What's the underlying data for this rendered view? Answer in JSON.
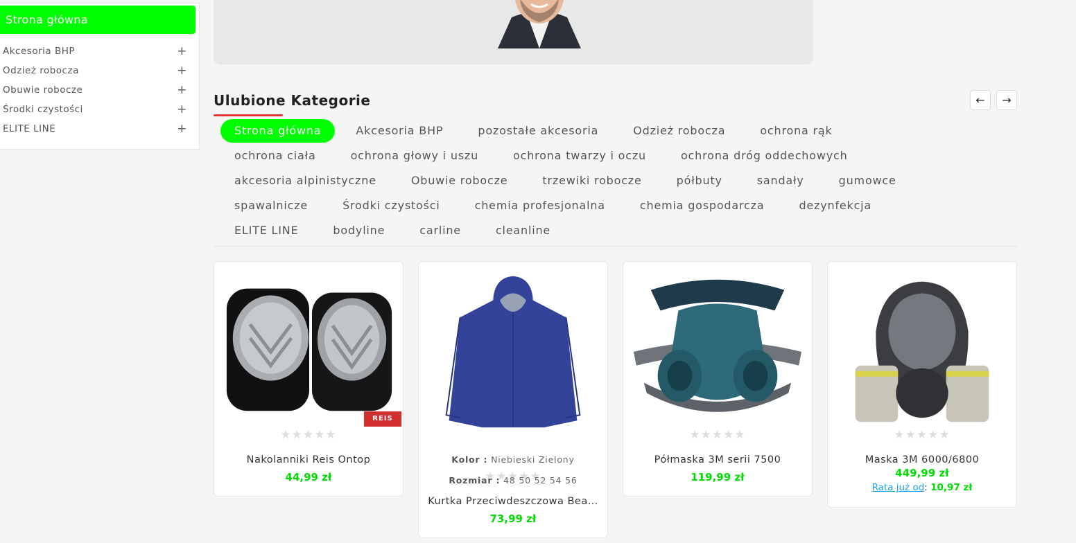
{
  "sidebar": {
    "heading": "Strona główna",
    "items": [
      {
        "label": "Akcesoria BHP",
        "expand": "+"
      },
      {
        "label": "Odzież robocza",
        "expand": "+"
      },
      {
        "label": "Obuwie robocze",
        "expand": "+"
      },
      {
        "label": "Środki czystości",
        "expand": "+"
      },
      {
        "label": "ELITE LINE",
        "expand": "+"
      }
    ]
  },
  "section": {
    "title": "Ulubione Kategorie",
    "prev": "←",
    "next": "→",
    "accent_color": "#e53935"
  },
  "categories": {
    "active_color": "#00ff00",
    "rows": [
      [
        "Strona główna",
        "Akcesoria BHP",
        "pozostałe akcesoria",
        "Odzież robocza",
        "ochrona rąk"
      ],
      [
        "ochrona ciała",
        "ochrona głowy i uszu",
        "ochrona twarzy i oczu",
        "ochrona dróg oddechowych"
      ],
      [
        "akcesoria alpinistyczne",
        "Obuwie robocze",
        "trzewiki robocze",
        "półbuty",
        "sandały",
        "gumowce"
      ],
      [
        "spawalnicze",
        "Środki czystości",
        "chemia profesjonalna",
        "chemia gospodarcza",
        "dezynfekcja"
      ],
      [
        "ELITE LINE",
        "bodyline",
        "carline",
        "cleanline"
      ]
    ]
  },
  "products": [
    {
      "name": "Nakolanniki Reis Ontop",
      "price": "44,99 zł",
      "stars": "★★★★★",
      "badge": "REIS"
    },
    {
      "name": "Kurtka Przeciwdeszczowa Bea…",
      "price": "73,99 zł",
      "stars": "★★★★★",
      "color_label": "Kolor :",
      "colors": "Niebieski  Zielony",
      "size_label": "Rozmiar :",
      "sizes": "48  50  52  54  56"
    },
    {
      "name": "Półmaska 3M serii 7500",
      "price": "119,99 zł",
      "stars": "★★★★★"
    },
    {
      "name": "Maska 3M 6000/6800",
      "price": "449,99 zł",
      "stars": "★★★★★",
      "rata_label": "Rata już od",
      "rata_sep": ": ",
      "rata_value": "10,97 zł"
    }
  ]
}
